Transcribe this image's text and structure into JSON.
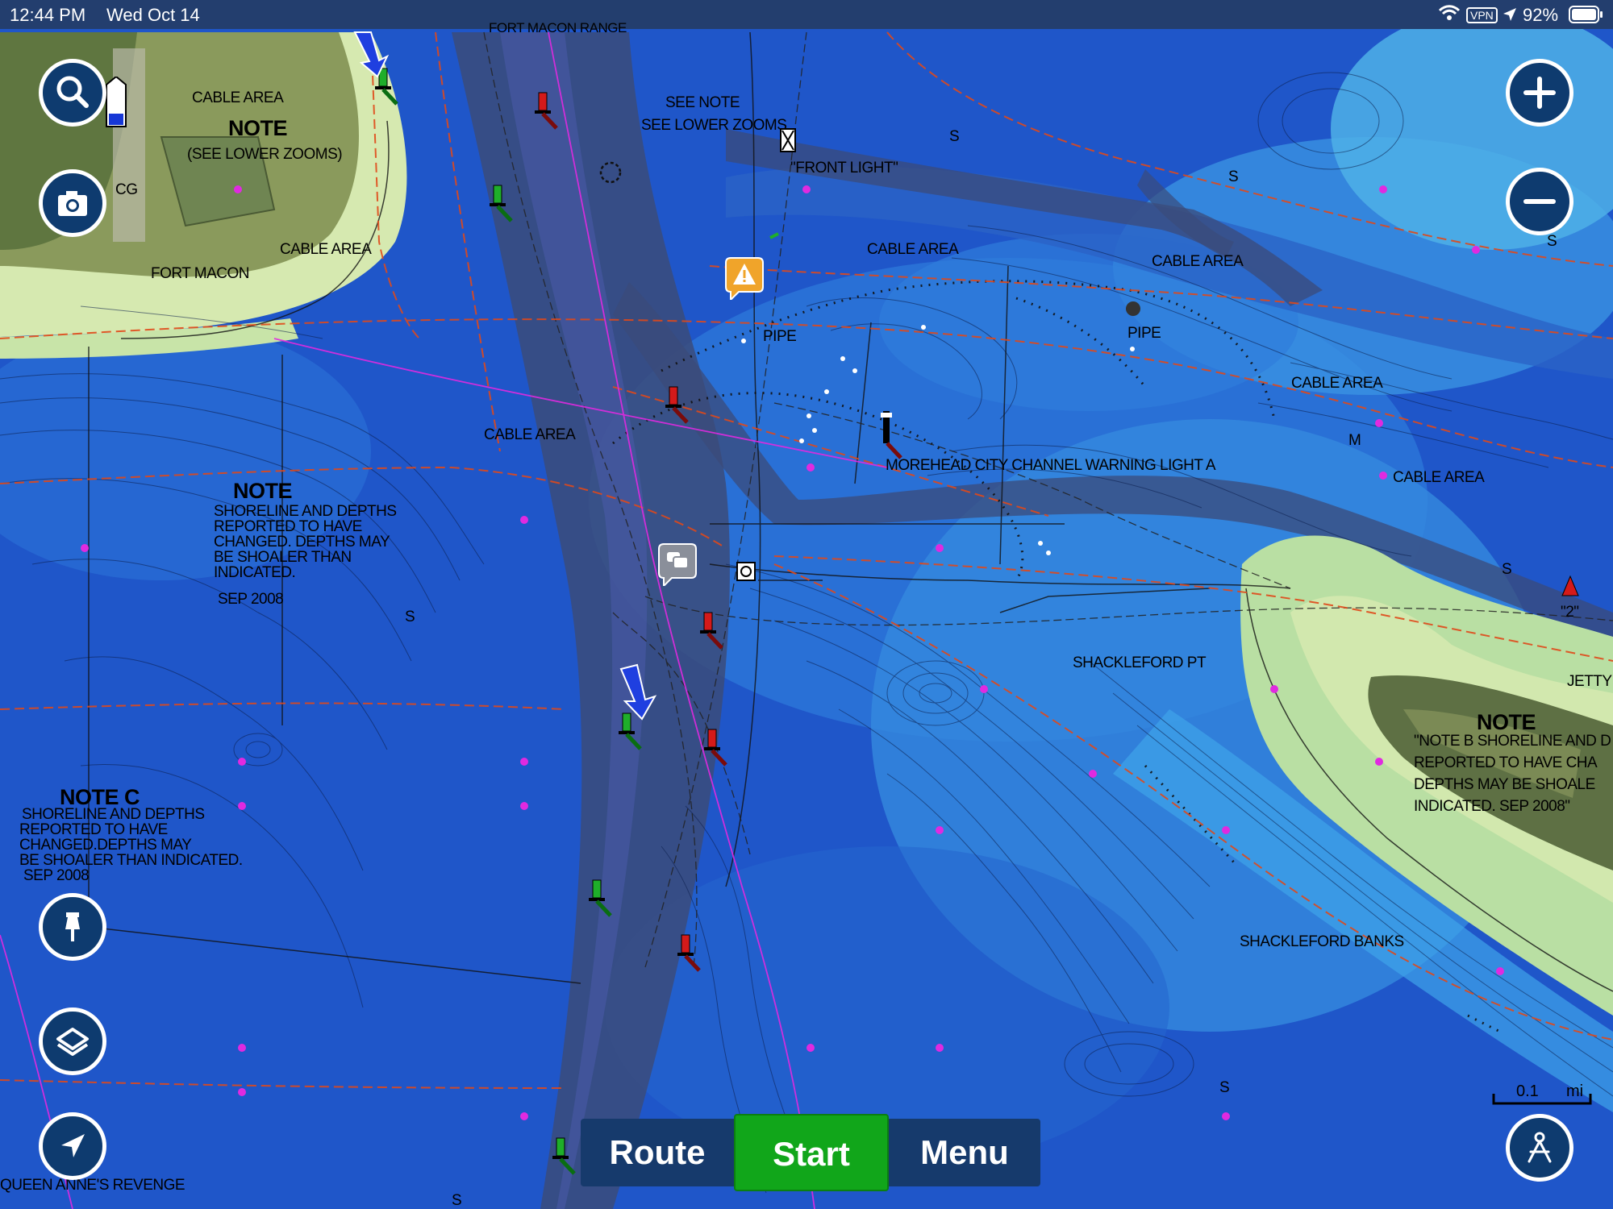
{
  "status_bar": {
    "time": "12:44 PM",
    "date": "Wed Oct 14",
    "vpn": "VPN",
    "battery": "92%"
  },
  "map_labels": {
    "fort_macon_range": "FORT MACON RANGE",
    "see_note": "SEE NOTE",
    "see_lower_zooms": "SEE LOWER ZOOMS",
    "front_light": "\"FRONT LIGHT\"",
    "cable_area": "CABLE AREA",
    "note": "NOTE",
    "see_lower_zooms_paren": "(SEE LOWER ZOOMS)",
    "cg": "CG",
    "fort_macon": "FORT MACON",
    "pipe": "PIPE",
    "morehead_light": "MOREHEAD CITY CHANNEL WARNING LIGHT A",
    "shackleford_pt": "SHACKLEFORD PT",
    "shackleford_banks": "SHACKLEFORD BANKS",
    "jetty": "JETTY",
    "queen_annes": "QUEEN ANNE'S REVENGE",
    "buoy_2": "\"2\"",
    "s": "S",
    "m": "M"
  },
  "notes": {
    "left_note": {
      "title": "NOTE",
      "lines": [
        "SHORELINE AND DEPTHS",
        "REPORTED TO HAVE",
        "CHANGED. DEPTHS MAY",
        "BE SHOALER THAN",
        "INDICATED."
      ],
      "date": "SEP 2008"
    },
    "note_c": {
      "title": "NOTE C",
      "lines": [
        "SHORELINE AND DEPTHS",
        "REPORTED TO HAVE",
        "CHANGED.DEPTHS MAY",
        "BE SHOALER THAN INDICATED."
      ],
      "date": "SEP 2008"
    },
    "right_note": {
      "title": "NOTE",
      "lines": [
        "\"NOTE B SHORELINE AND D",
        "REPORTED TO HAVE CHA",
        "DEPTHS MAY BE SHOALE",
        "INDICATED. SEP 2008\""
      ]
    }
  },
  "bottom_bar": {
    "route": "Route",
    "start": "Start",
    "menu": "Menu"
  },
  "scale": {
    "value": "0.1",
    "unit": "mi"
  },
  "colors": {
    "deep_water": "#1f56c9",
    "shallow_water": "#38a0e8",
    "sand": "#d6e9b0",
    "land": "#7b8a55",
    "button_bg": "#0e3b6f",
    "start_green": "#11a61a",
    "status_bar": "#233e6e"
  },
  "icons": [
    "search-icon",
    "camera-icon",
    "pin-icon",
    "layers-icon",
    "locate-icon",
    "zoom-in-icon",
    "zoom-out-icon",
    "track-up-icon",
    "warning-icon",
    "chat-icon",
    "wifi-icon",
    "location-arrow-icon",
    "battery-icon"
  ]
}
